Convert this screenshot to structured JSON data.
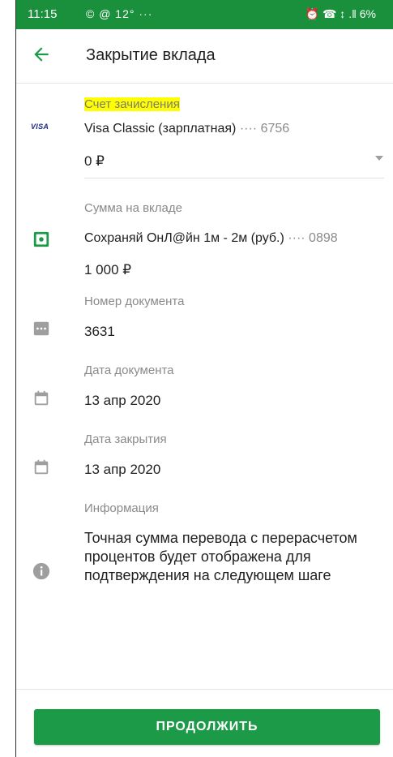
{
  "status_bar": {
    "time": "11:15",
    "left_icons": "© @ 12° ···",
    "right_icons": "⏰ ☎ ↕ .‖ 6%"
  },
  "header": {
    "title": "Закрытие вклада"
  },
  "credit_account": {
    "label": "Счет зачисления",
    "card_brand": "VISA",
    "card_name": "Visa Classic (зарплатная)",
    "card_dots": "····",
    "card_last4": "6756",
    "amount": "0 ₽"
  },
  "deposit": {
    "label": "Сумма на вкладе",
    "name": "Сохраняй ОнЛ@йн 1м - 2м (руб.)",
    "dots": "····",
    "last4": "0898",
    "amount": "1 000 ₽"
  },
  "document_number": {
    "label": "Номер документа",
    "value": "3631"
  },
  "document_date": {
    "label": "Дата документа",
    "value": "13 апр 2020"
  },
  "closing_date": {
    "label": "Дата закрытия",
    "value": "13 апр 2020"
  },
  "information": {
    "label": "Информация",
    "text": "Точная сумма перевода с перерасчетом процентов будет отображена для подтверждения на следующем шаге"
  },
  "actions": {
    "continue_label": "ПРОДОЛЖИТЬ"
  },
  "colors": {
    "brand_green": "#1c9a48",
    "status_green": "#1a8f3c",
    "highlight": "#ffff00"
  }
}
